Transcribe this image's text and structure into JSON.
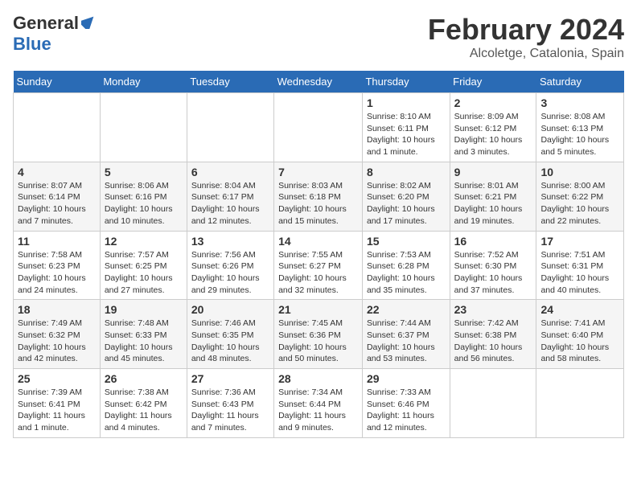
{
  "header": {
    "logo": {
      "general": "General",
      "blue": "Blue"
    },
    "title": "February 2024",
    "location": "Alcoletge, Catalonia, Spain"
  },
  "calendar": {
    "days_of_week": [
      "Sunday",
      "Monday",
      "Tuesday",
      "Wednesday",
      "Thursday",
      "Friday",
      "Saturday"
    ],
    "weeks": [
      [
        {
          "day": "",
          "info": ""
        },
        {
          "day": "",
          "info": ""
        },
        {
          "day": "",
          "info": ""
        },
        {
          "day": "",
          "info": ""
        },
        {
          "day": "1",
          "info": "Sunrise: 8:10 AM\nSunset: 6:11 PM\nDaylight: 10 hours and 1 minute."
        },
        {
          "day": "2",
          "info": "Sunrise: 8:09 AM\nSunset: 6:12 PM\nDaylight: 10 hours and 3 minutes."
        },
        {
          "day": "3",
          "info": "Sunrise: 8:08 AM\nSunset: 6:13 PM\nDaylight: 10 hours and 5 minutes."
        }
      ],
      [
        {
          "day": "4",
          "info": "Sunrise: 8:07 AM\nSunset: 6:14 PM\nDaylight: 10 hours and 7 minutes."
        },
        {
          "day": "5",
          "info": "Sunrise: 8:06 AM\nSunset: 6:16 PM\nDaylight: 10 hours and 10 minutes."
        },
        {
          "day": "6",
          "info": "Sunrise: 8:04 AM\nSunset: 6:17 PM\nDaylight: 10 hours and 12 minutes."
        },
        {
          "day": "7",
          "info": "Sunrise: 8:03 AM\nSunset: 6:18 PM\nDaylight: 10 hours and 15 minutes."
        },
        {
          "day": "8",
          "info": "Sunrise: 8:02 AM\nSunset: 6:20 PM\nDaylight: 10 hours and 17 minutes."
        },
        {
          "day": "9",
          "info": "Sunrise: 8:01 AM\nSunset: 6:21 PM\nDaylight: 10 hours and 19 minutes."
        },
        {
          "day": "10",
          "info": "Sunrise: 8:00 AM\nSunset: 6:22 PM\nDaylight: 10 hours and 22 minutes."
        }
      ],
      [
        {
          "day": "11",
          "info": "Sunrise: 7:58 AM\nSunset: 6:23 PM\nDaylight: 10 hours and 24 minutes."
        },
        {
          "day": "12",
          "info": "Sunrise: 7:57 AM\nSunset: 6:25 PM\nDaylight: 10 hours and 27 minutes."
        },
        {
          "day": "13",
          "info": "Sunrise: 7:56 AM\nSunset: 6:26 PM\nDaylight: 10 hours and 29 minutes."
        },
        {
          "day": "14",
          "info": "Sunrise: 7:55 AM\nSunset: 6:27 PM\nDaylight: 10 hours and 32 minutes."
        },
        {
          "day": "15",
          "info": "Sunrise: 7:53 AM\nSunset: 6:28 PM\nDaylight: 10 hours and 35 minutes."
        },
        {
          "day": "16",
          "info": "Sunrise: 7:52 AM\nSunset: 6:30 PM\nDaylight: 10 hours and 37 minutes."
        },
        {
          "day": "17",
          "info": "Sunrise: 7:51 AM\nSunset: 6:31 PM\nDaylight: 10 hours and 40 minutes."
        }
      ],
      [
        {
          "day": "18",
          "info": "Sunrise: 7:49 AM\nSunset: 6:32 PM\nDaylight: 10 hours and 42 minutes."
        },
        {
          "day": "19",
          "info": "Sunrise: 7:48 AM\nSunset: 6:33 PM\nDaylight: 10 hours and 45 minutes."
        },
        {
          "day": "20",
          "info": "Sunrise: 7:46 AM\nSunset: 6:35 PM\nDaylight: 10 hours and 48 minutes."
        },
        {
          "day": "21",
          "info": "Sunrise: 7:45 AM\nSunset: 6:36 PM\nDaylight: 10 hours and 50 minutes."
        },
        {
          "day": "22",
          "info": "Sunrise: 7:44 AM\nSunset: 6:37 PM\nDaylight: 10 hours and 53 minutes."
        },
        {
          "day": "23",
          "info": "Sunrise: 7:42 AM\nSunset: 6:38 PM\nDaylight: 10 hours and 56 minutes."
        },
        {
          "day": "24",
          "info": "Sunrise: 7:41 AM\nSunset: 6:40 PM\nDaylight: 10 hours and 58 minutes."
        }
      ],
      [
        {
          "day": "25",
          "info": "Sunrise: 7:39 AM\nSunset: 6:41 PM\nDaylight: 11 hours and 1 minute."
        },
        {
          "day": "26",
          "info": "Sunrise: 7:38 AM\nSunset: 6:42 PM\nDaylight: 11 hours and 4 minutes."
        },
        {
          "day": "27",
          "info": "Sunrise: 7:36 AM\nSunset: 6:43 PM\nDaylight: 11 hours and 7 minutes."
        },
        {
          "day": "28",
          "info": "Sunrise: 7:34 AM\nSunset: 6:44 PM\nDaylight: 11 hours and 9 minutes."
        },
        {
          "day": "29",
          "info": "Sunrise: 7:33 AM\nSunset: 6:46 PM\nDaylight: 11 hours and 12 minutes."
        },
        {
          "day": "",
          "info": ""
        },
        {
          "day": "",
          "info": ""
        }
      ]
    ]
  }
}
